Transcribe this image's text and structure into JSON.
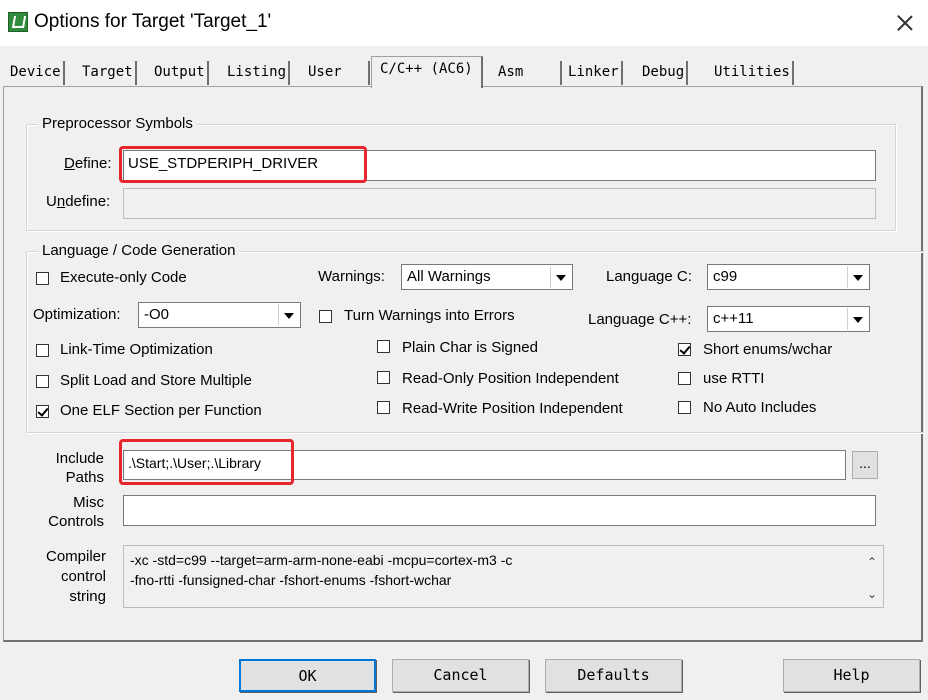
{
  "window": {
    "title": "Options for Target 'Target_1'"
  },
  "tabs": [
    {
      "label": "Device"
    },
    {
      "label": "Target"
    },
    {
      "label": "Output"
    },
    {
      "label": "Listing"
    },
    {
      "label": "User"
    },
    {
      "label": "C/C++ (AC6)",
      "active": true
    },
    {
      "label": "Asm"
    },
    {
      "label": "Linker"
    },
    {
      "label": "Debug"
    },
    {
      "label": "Utilities"
    }
  ],
  "preprocessor": {
    "group_title": "Preprocessor Symbols",
    "define_label": "Define:",
    "define_value": "USE_STDPERIPH_DRIVER",
    "undefine_label": "Undefine:",
    "undefine_value": ""
  },
  "language": {
    "group_title": "Language / Code Generation",
    "execute_only": {
      "label": "Execute-only Code",
      "checked": false
    },
    "optimization_label": "Optimization:",
    "optimization_value": "-O0",
    "link_time": {
      "label": "Link-Time Optimization",
      "checked": false
    },
    "split_load": {
      "label": "Split Load and Store Multiple",
      "checked": false
    },
    "one_elf": {
      "label": "One ELF Section per Function",
      "checked": true
    },
    "warnings_label": "Warnings:",
    "warnings_value": "All Warnings",
    "turn_warnings": {
      "label": "Turn Warnings into Errors",
      "checked": false
    },
    "plain_char": {
      "label": "Plain Char is Signed",
      "checked": false
    },
    "ro_pi": {
      "label": "Read-Only Position Independent",
      "checked": false
    },
    "rw_pi": {
      "label": "Read-Write Position Independent",
      "checked": false
    },
    "lang_c_label": "Language C:",
    "lang_c_value": "c99",
    "lang_cpp_label": "Language C++:",
    "lang_cpp_value": "c++11",
    "short_enums": {
      "label": "Short enums/wchar",
      "checked": true
    },
    "use_rtti": {
      "label": "use RTTI",
      "checked": false
    },
    "no_auto_includes": {
      "label": "No Auto Includes",
      "checked": false
    }
  },
  "include": {
    "label_line1": "Include",
    "label_line2": "Paths",
    "value": ".\\Start;.\\User;.\\Library",
    "browse_label": "..."
  },
  "misc": {
    "label_line1": "Misc",
    "label_line2": "Controls",
    "value": ""
  },
  "compiler": {
    "label_line1": "Compiler",
    "label_line2": "control",
    "label_line3": "string",
    "line1": "-xc -std=c99 --target=arm-arm-none-eabi -mcpu=cortex-m3 -c",
    "line2": "-fno-rtti -funsigned-char -fshort-enums -fshort-wchar"
  },
  "buttons": {
    "ok": "OK",
    "cancel": "Cancel",
    "defaults": "Defaults",
    "help": "Help"
  },
  "colors": {
    "highlight": "#e8262d",
    "dialog_bg": "#f0f0f0"
  }
}
